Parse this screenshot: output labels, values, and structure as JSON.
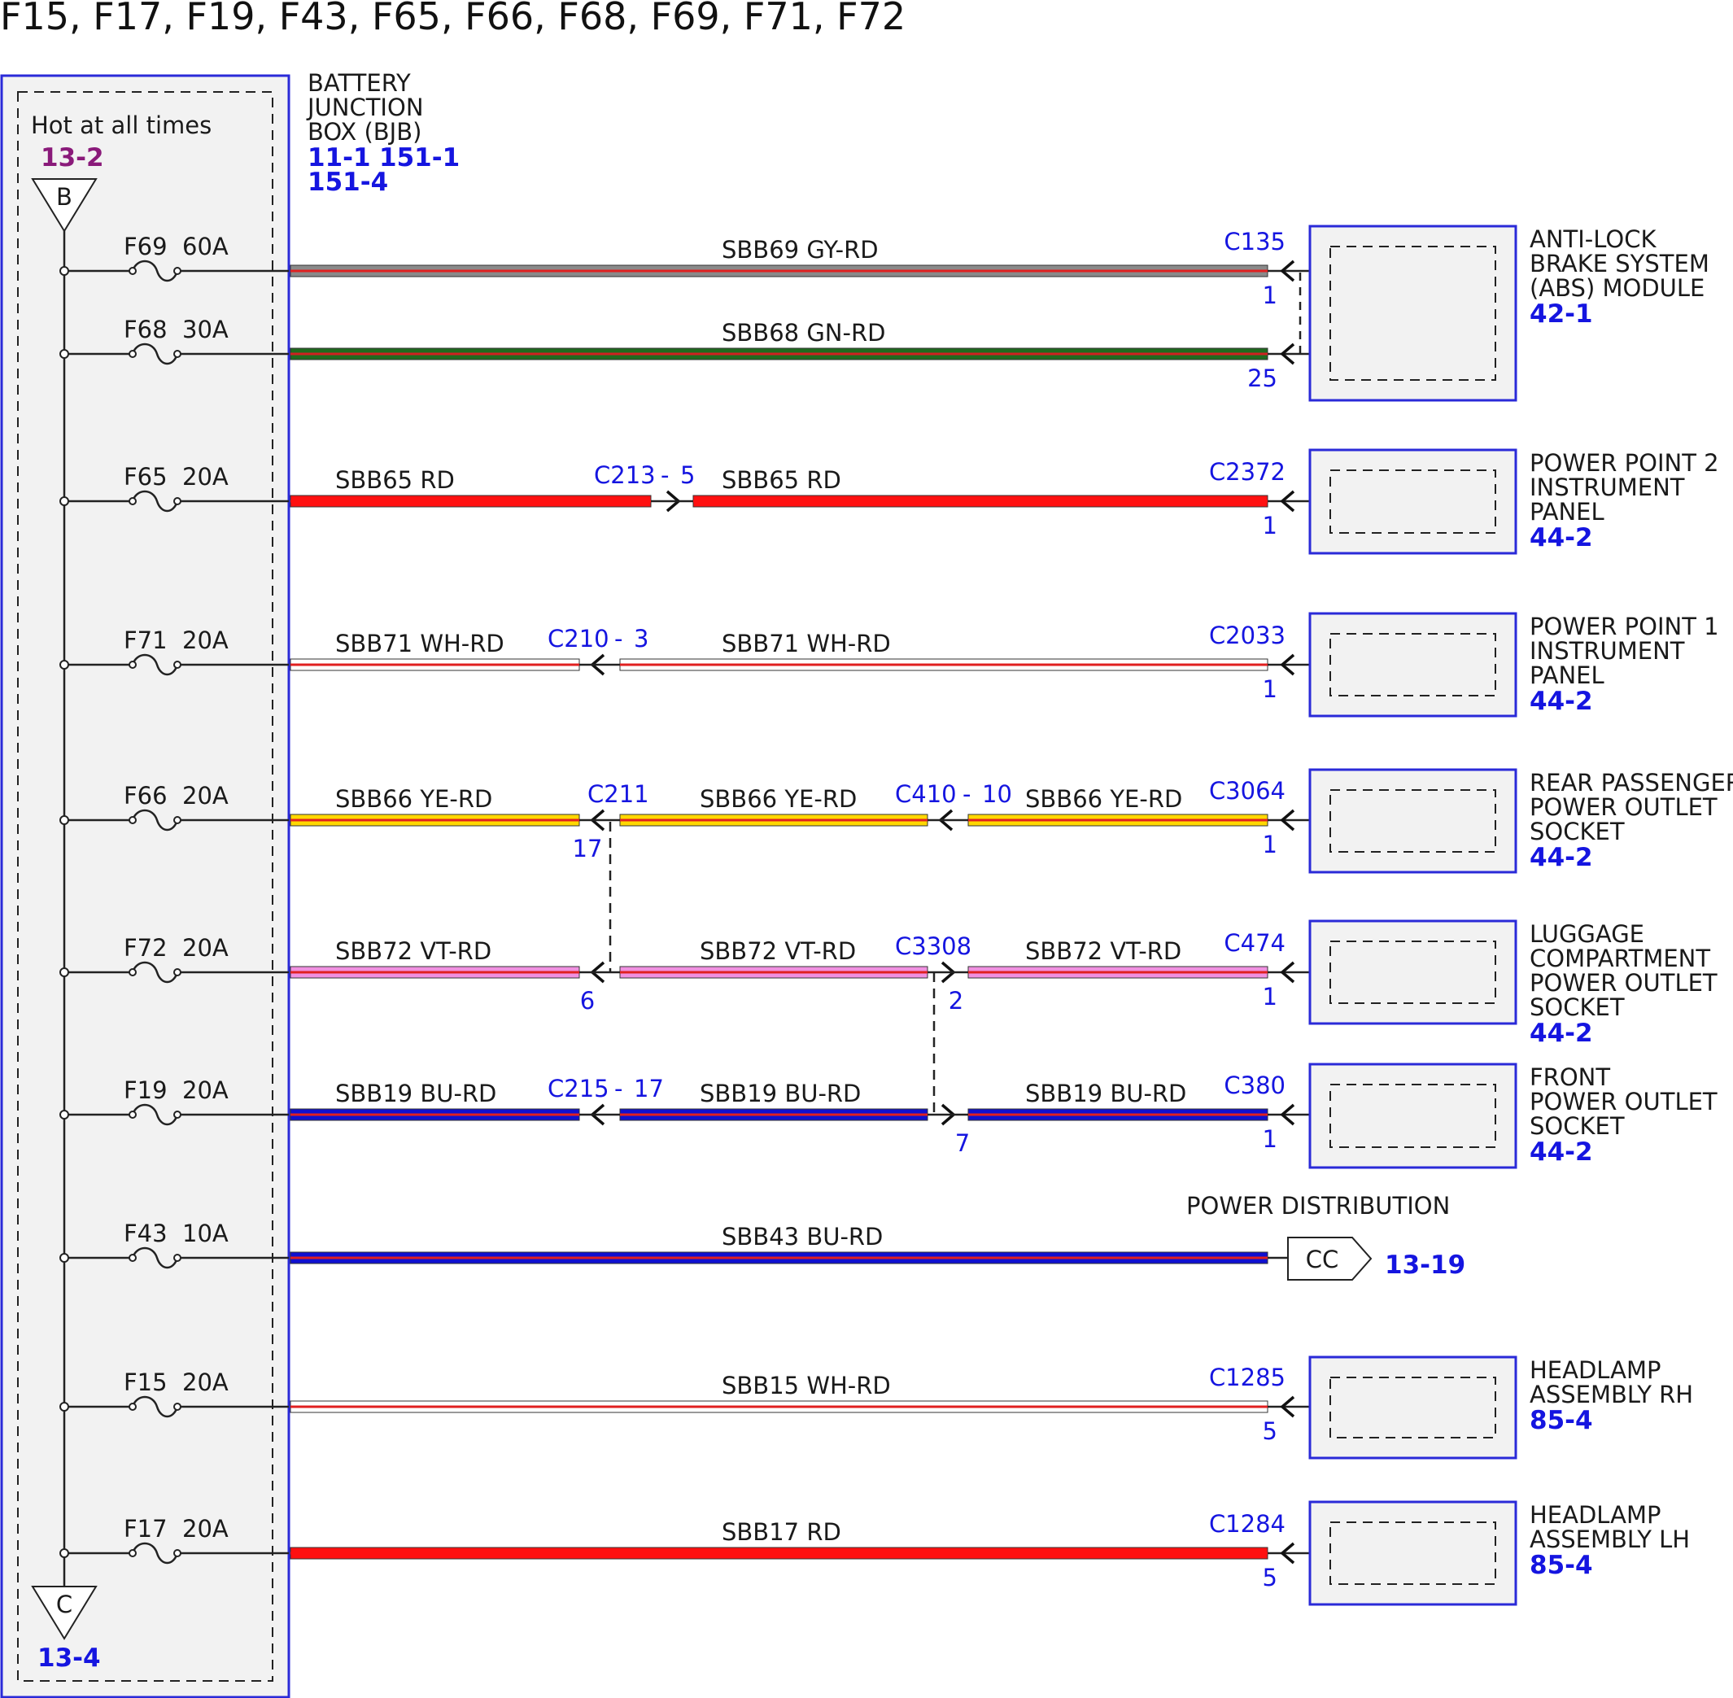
{
  "title": "F15, F17, F19, F43, F65, F66, F68, F69, F71, F72",
  "colors": {
    "link_blue": "#1515e0",
    "ref_purple": "#8a1a7a",
    "box_fill": "#f2f2f2",
    "box_border": "#2a2ad8"
  },
  "bjb": {
    "name_lines": [
      "BATTERY",
      "JUNCTION",
      "BOX (BJB)"
    ],
    "refs_line1": [
      "11-1",
      "151-1"
    ],
    "refs_line2": "151-4",
    "hot_label": "Hot at all times",
    "top_ref": "13-2",
    "top_connector": "B",
    "bottom_connector": "C",
    "bottom_ref": "13-4"
  },
  "fuses": [
    {
      "id": "F69",
      "rating": "60A"
    },
    {
      "id": "F68",
      "rating": "30A"
    },
    {
      "id": "F65",
      "rating": "20A"
    },
    {
      "id": "F71",
      "rating": "20A"
    },
    {
      "id": "F66",
      "rating": "20A"
    },
    {
      "id": "F72",
      "rating": "20A"
    },
    {
      "id": "F19",
      "rating": "20A"
    },
    {
      "id": "F43",
      "rating": "10A"
    },
    {
      "id": "F15",
      "rating": "20A"
    },
    {
      "id": "F17",
      "rating": "20A"
    }
  ],
  "circuits": [
    {
      "fuse": "F69",
      "wire": "SBB69",
      "color": "GY-RD",
      "segments": [
        {
          "label": "SBB69  GY-RD"
        }
      ],
      "end_connector": "C135",
      "end_pin": "1",
      "base": "#8a8a8a",
      "stripe": "#e02020"
    },
    {
      "fuse": "F68",
      "wire": "SBB68",
      "color": "GN-RD",
      "segments": [
        {
          "label": "SBB68  GN-RD"
        }
      ],
      "end_connector": "",
      "end_pin": "25",
      "base": "#1f6b1f",
      "stripe": "#d02020"
    },
    {
      "fuse": "F65",
      "wire": "SBB65",
      "color": "RD",
      "segments": [
        {
          "label": "SBB65  RD"
        },
        {
          "label": "SBB65  RD"
        }
      ],
      "inline": [
        {
          "connector": "C213",
          "pin": "5"
        }
      ],
      "end_connector": "C2372",
      "end_pin": "1",
      "base": "#ff1010",
      "stripe": "#ff1010"
    },
    {
      "fuse": "F71",
      "wire": "SBB71",
      "color": "WH-RD",
      "segments": [
        {
          "label": "SBB71  WH-RD"
        },
        {
          "label": "SBB71  WH-RD"
        }
      ],
      "inline": [
        {
          "connector": "C210",
          "pin": "3"
        }
      ],
      "end_connector": "C2033",
      "end_pin": "1",
      "base": "#ffffff",
      "stripe": "#e02020"
    },
    {
      "fuse": "F66",
      "wire": "SBB66",
      "color": "YE-RD",
      "segments": [
        {
          "label": "SBB66  YE-RD"
        },
        {
          "label": "SBB66  YE-RD"
        },
        {
          "label": "SBB66  YE-RD"
        }
      ],
      "inline": [
        {
          "connector": "C211",
          "pin": "17"
        },
        {
          "connector": "C410",
          "pin": "10"
        }
      ],
      "end_connector": "C3064",
      "end_pin": "1",
      "base": "#ffd800",
      "stripe": "#e02020"
    },
    {
      "fuse": "F72",
      "wire": "SBB72",
      "color": "VT-RD",
      "segments": [
        {
          "label": "SBB72  VT-RD"
        },
        {
          "label": "SBB72  VT-RD"
        },
        {
          "label": "SBB72  VT-RD"
        }
      ],
      "inline": [
        {
          "connector": "",
          "pin": "6"
        },
        {
          "connector": "C3308",
          "pin": "2"
        }
      ],
      "end_connector": "C474",
      "end_pin": "1",
      "base": "#f090e0",
      "stripe": "#e02020"
    },
    {
      "fuse": "F19",
      "wire": "SBB19",
      "color": "BU-RD",
      "segments": [
        {
          "label": "SBB19  BU-RD"
        },
        {
          "label": "SBB19  BU-RD"
        },
        {
          "label": "SBB19  BU-RD"
        }
      ],
      "inline": [
        {
          "connector": "C215",
          "pin": "17"
        },
        {
          "connector": "",
          "pin": "7"
        }
      ],
      "end_connector": "C380",
      "end_pin": "1",
      "base": "#1010d0",
      "stripe": "#e02020"
    },
    {
      "fuse": "F43",
      "wire": "SBB43",
      "color": "BU-RD",
      "segments": [
        {
          "label": "SBB43  BU-RD"
        }
      ],
      "end_connector": "",
      "end_pin": "",
      "base": "#1010d0",
      "stripe": "#e02020"
    },
    {
      "fuse": "F15",
      "wire": "SBB15",
      "color": "WH-RD",
      "segments": [
        {
          "label": "SBB15  WH-RD"
        }
      ],
      "end_connector": "C1285",
      "end_pin": "5",
      "base": "#ffffff",
      "stripe": "#e02020"
    },
    {
      "fuse": "F17",
      "wire": "SBB17",
      "color": "RD",
      "segments": [
        {
          "label": "SBB17  RD"
        }
      ],
      "end_connector": "C1284",
      "end_pin": "5",
      "base": "#ff1010",
      "stripe": "#ff1010"
    }
  ],
  "components": [
    {
      "name_lines": [
        "ANTI-LOCK",
        "BRAKE SYSTEM",
        "(ABS) MODULE"
      ],
      "ref": "42-1"
    },
    {
      "name_lines": [
        "POWER POINT 2",
        "INSTRUMENT",
        "PANEL"
      ],
      "ref": "44-2"
    },
    {
      "name_lines": [
        "POWER POINT 1",
        "INSTRUMENT",
        "PANEL"
      ],
      "ref": "44-2"
    },
    {
      "name_lines": [
        "REAR PASSENGER",
        "POWER OUTLET",
        "SOCKET"
      ],
      "ref": "44-2"
    },
    {
      "name_lines": [
        "LUGGAGE",
        "COMPARTMENT",
        "POWER OUTLET",
        "SOCKET"
      ],
      "ref": "44-2"
    },
    {
      "name_lines": [
        "FRONT",
        "POWER OUTLET",
        "SOCKET"
      ],
      "ref": "44-2"
    },
    {
      "name_lines": [
        "HEADLAMP",
        "ASSEMBLY RH"
      ],
      "ref": "85-4"
    },
    {
      "name_lines": [
        "HEADLAMP",
        "ASSEMBLY LH"
      ],
      "ref": "85-4"
    }
  ],
  "power_distribution": {
    "label": "POWER DISTRIBUTION",
    "connector": "CC",
    "ref": "13-19"
  }
}
